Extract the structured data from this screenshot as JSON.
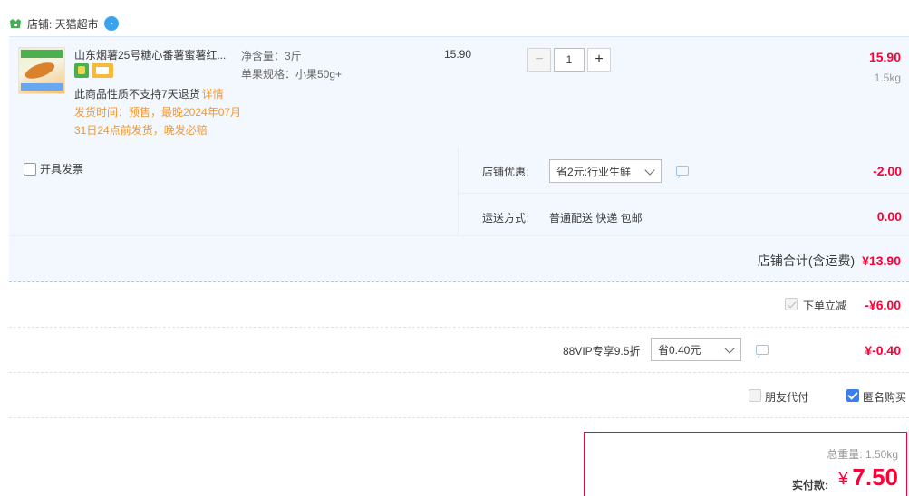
{
  "shop": {
    "label": "店铺: 天猫超市"
  },
  "item": {
    "title": "山东烟薯25号糖心番薯蜜薯红...",
    "note": "此商品性质不支持7天退货",
    "note_link": "详情",
    "ship_time": "发货时间：预售，最晚2024年07月31日24点前发货，晚发必赔",
    "net_weight": "净含量：3斤",
    "spec": "单果规格：小果50g+",
    "unit_price": "15.90",
    "quantity": "1",
    "subtotal": "15.90",
    "weight": "1.5kg"
  },
  "invoice": {
    "label": "开具发票"
  },
  "promo": {
    "shop_discount_label": "店铺优惠:",
    "shop_discount_select": "省2元:行业生鲜",
    "shop_discount_amount": "-2.00",
    "shipping_label": "运送方式:",
    "shipping_value": "普通配送 快递 包邮",
    "shipping_amount": "0.00"
  },
  "shop_total": {
    "label": "店铺合计(含运费)",
    "value": "¥13.90"
  },
  "instant_discount": {
    "label": "下单立减",
    "amount": "-¥6.00"
  },
  "vip": {
    "label": "88VIP专享9.5折",
    "select": "省0.40元",
    "amount": "¥-0.40"
  },
  "options": {
    "friend_pay": "朋友代付",
    "anonymous": "匿名购买"
  },
  "payment": {
    "total_weight": "总重量: 1.50kg",
    "label": "实付款:",
    "currency": "¥",
    "amount": "7.50"
  },
  "colors": {
    "accent_red": "#ff0036",
    "orange": "#f29731",
    "light_blue_bg": "#f3f8fe",
    "check_blue": "#3a7ff0"
  }
}
